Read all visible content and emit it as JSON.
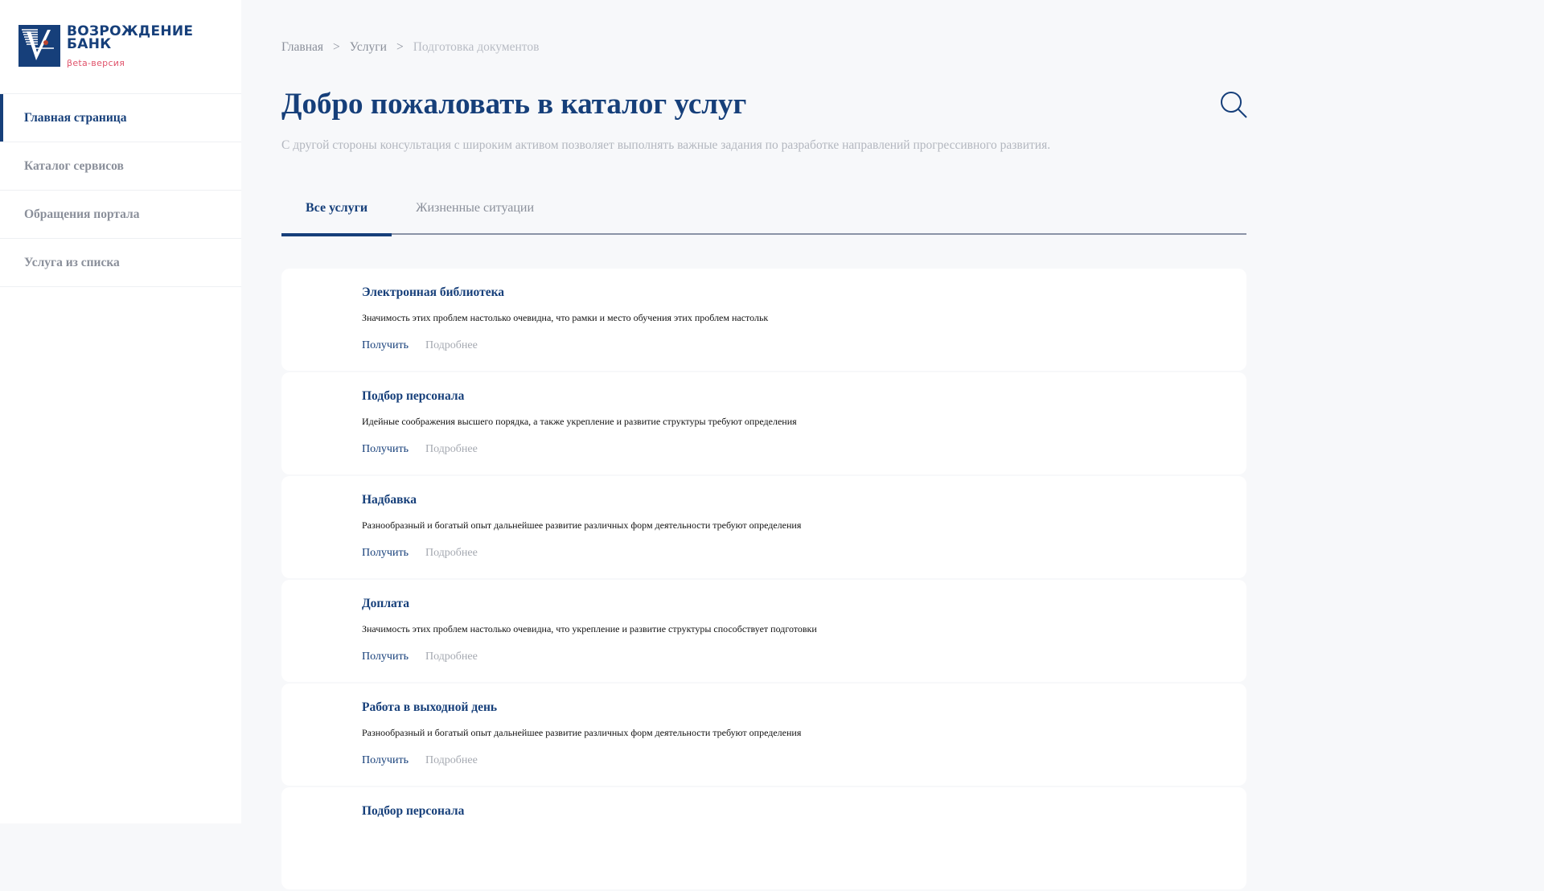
{
  "logo": {
    "line1": "ВОЗРОЖДЕНИЕ",
    "line2": "БАНК",
    "beta": "βeta-версия"
  },
  "nav": [
    {
      "label": "Главная страница",
      "active": true
    },
    {
      "label": "Каталог сервисов"
    },
    {
      "label": "Обращения портала"
    },
    {
      "label": "Услуга из списка"
    }
  ],
  "breadcrumb": {
    "items": [
      "Главная",
      "Услуги",
      "Подготовка документов"
    ],
    "sep": ">"
  },
  "title": "Добро пожаловать в каталог услуг",
  "subtitle": "С другой стороны консультация с широким активом позволяет выполнять важные задания по разработке направлений прогрессивного развития.",
  "tabs": [
    {
      "label": "Все услуги",
      "active": true
    },
    {
      "label": "Жизненные ситуации"
    }
  ],
  "cards": [
    {
      "title": "Электронная библиотека",
      "desc": "Значимость этих проблем настолько очевидна, что рамки и место обучения этих проблем настольк",
      "get": "Получить",
      "more": "Подробнее"
    },
    {
      "title": "Подбор персонала",
      "desc": "Идейные соображения высшего порядка, а также укрепление и развитие структуры требуют определения",
      "get": "Получить",
      "more": "Подробнее"
    },
    {
      "title": "Надбавка",
      "desc": "Разнообразный и богатый опыт дальнейшее развитие различных форм деятельности требуют определения",
      "get": "Получить",
      "more": "Подробнее"
    },
    {
      "title": "Доплата",
      "desc": "Значимость этих проблем настолько очевидна, что укрепление и развитие структуры способствует подготовки",
      "get": "Получить",
      "more": "Подробнее"
    },
    {
      "title": "Работа в выходной день",
      "desc": "Разнообразный и богатый опыт дальнейшее развитие различных форм деятельности требуют определения",
      "get": "Получить",
      "more": "Подробнее"
    },
    {
      "title": "Подбор персонала"
    }
  ]
}
